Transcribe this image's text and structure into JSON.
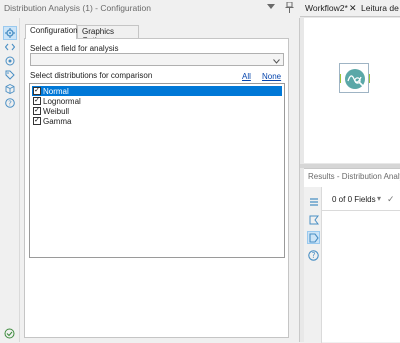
{
  "config_window": {
    "title": "Distribution Analysis (1) - Configuration",
    "controls": {
      "dropdown": "▾",
      "pin": "📌"
    }
  },
  "tabs": {
    "configuration": "Configuration",
    "graphics": "Graphics Options"
  },
  "form": {
    "field_label": "Select a field for analysis",
    "field_value": "",
    "distributions_label": "Select distributions for comparison",
    "all_link": "All",
    "none_link": "None",
    "distributions": [
      {
        "label": "Normal",
        "checked": true,
        "selected": true
      },
      {
        "label": "Lognormal",
        "checked": true,
        "selected": false
      },
      {
        "label": "Weibull",
        "checked": true,
        "selected": false
      },
      {
        "label": "Gamma",
        "checked": true,
        "selected": false
      }
    ]
  },
  "workflow": {
    "tabs": {
      "workflow": "Workflow2*",
      "close": "✕",
      "leitura": "Leitura de F"
    }
  },
  "results": {
    "title": "Results - Distribution Analysis",
    "fields_count": "0 of 0 Fields",
    "dropdown": "▾",
    "check": "✓"
  },
  "colors": {
    "selection": "#0078d7",
    "accent_icon": "#4a8fc4",
    "tool_teal": "#5ba8a8"
  }
}
